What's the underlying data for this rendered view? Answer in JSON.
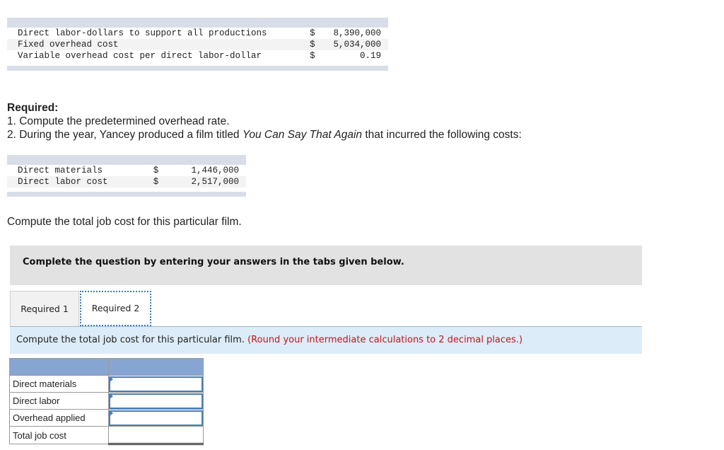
{
  "top_table": {
    "rows": [
      {
        "label": "Direct labor-dollars to support all productions",
        "currency": "$",
        "value": "8,390,000"
      },
      {
        "label": "Fixed overhead cost",
        "currency": "$",
        "value": "5,034,000"
      },
      {
        "label": "Variable overhead cost per direct labor-dollar",
        "currency": "$",
        "value": "0.19"
      }
    ]
  },
  "required": {
    "heading": "Required:",
    "item1": "1. Compute the predetermined overhead rate.",
    "item2_pre": "2. During the year, Yancey produced a film titled ",
    "item2_title": "You Can Say That Again",
    "item2_post": " that incurred the following costs:"
  },
  "film_table": {
    "rows": [
      {
        "label": "Direct materials",
        "currency": "$",
        "value": "1,446,000"
      },
      {
        "label": "Direct labor cost",
        "currency": "$",
        "value": "2,517,000"
      }
    ]
  },
  "compute_text": "Compute the total job cost for this particular film.",
  "instruction": "Complete the question by entering your answers in the tabs given below.",
  "tabs": [
    {
      "label": "Required 1",
      "active": false
    },
    {
      "label": "Required 2",
      "active": true
    }
  ],
  "task": {
    "text": "Compute the total job cost for this particular film.",
    "hint": "(Round your intermediate calculations to 2 decimal places.)"
  },
  "answer_table": {
    "rows": [
      {
        "label": "Direct materials",
        "value": ""
      },
      {
        "label": "Direct labor",
        "value": ""
      },
      {
        "label": "Overhead applied",
        "value": ""
      },
      {
        "label": "Total job cost",
        "value": ""
      }
    ]
  }
}
